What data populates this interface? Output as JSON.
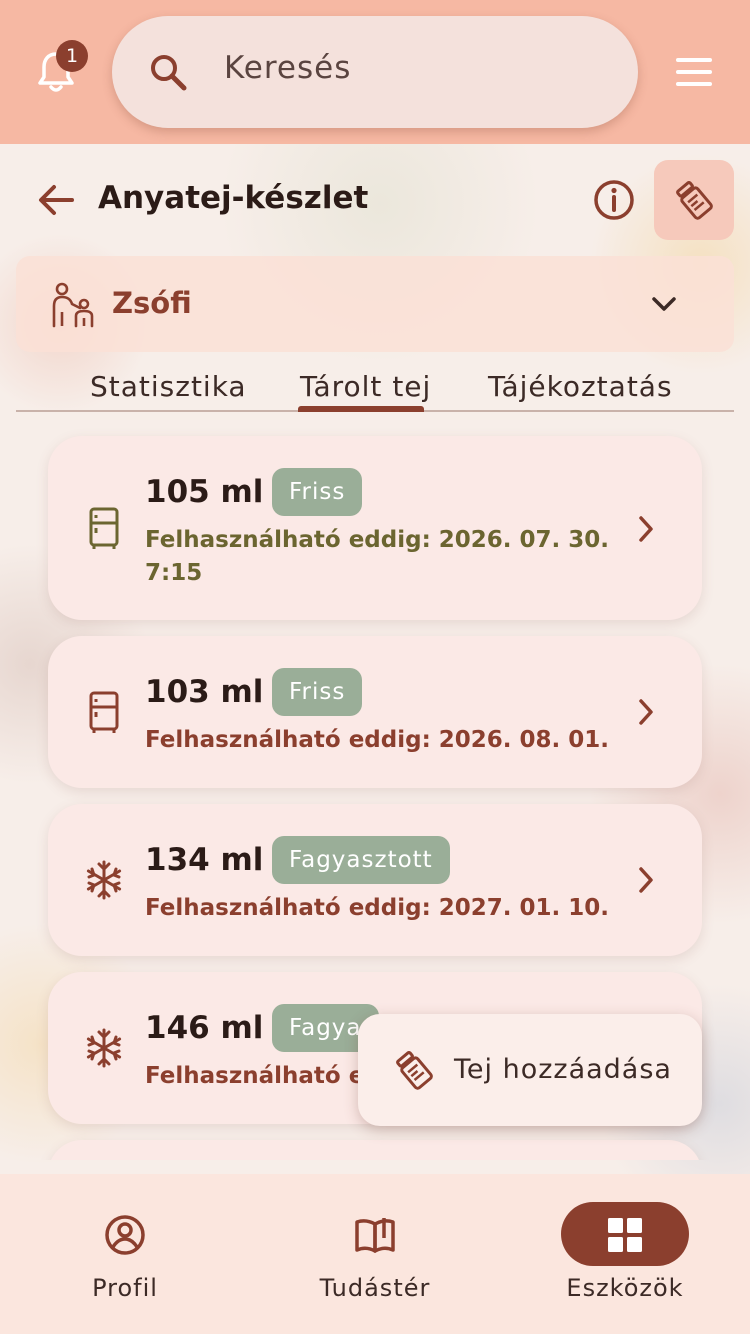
{
  "top_bar": {
    "notification_count": "1",
    "search_placeholder": "Keresés"
  },
  "header": {
    "title": "Anyatej-készlet"
  },
  "child": {
    "name": "Zsófi"
  },
  "tabs": [
    {
      "label": "Statisztika",
      "active": false
    },
    {
      "label": "Tárolt tej",
      "active": true
    },
    {
      "label": "Tájékoztatás",
      "active": false
    }
  ],
  "items": [
    {
      "amount": "105 ml",
      "status": "Friss",
      "icon": "fridge-icon",
      "expiry": "Felhasználható eddig: 2026. 07. 30. 7:15",
      "expiry_color": "#6b6530"
    },
    {
      "amount": "103 ml",
      "status": "Friss",
      "icon": "fridge-icon",
      "expiry": "Felhasználható eddig: 2026. 08. 01.",
      "expiry_color": "#8b3f2e"
    },
    {
      "amount": "134 ml",
      "status": "Fagyasztott",
      "icon": "snowflake-icon",
      "expiry": "Felhasználható eddig: 2027. 01. 10.",
      "expiry_color": "#8b3f2e"
    },
    {
      "amount": "146 ml",
      "status": "Fagya",
      "icon": "snowflake-icon",
      "expiry": "Felhasználható e",
      "expiry_color": "#8b3f2e"
    }
  ],
  "fab": {
    "label": "Tej hozzáadása"
  },
  "bottom_nav": [
    {
      "label": "Profil",
      "icon": "profile-icon",
      "active": false
    },
    {
      "label": "Tudástér",
      "icon": "book-icon",
      "active": false
    },
    {
      "label": "Eszközök",
      "icon": "grid-icon",
      "active": true
    }
  ],
  "colors": {
    "accent": "#8b3f2e",
    "top_bar": "#f6b8a3",
    "badge": "#9aae98"
  }
}
